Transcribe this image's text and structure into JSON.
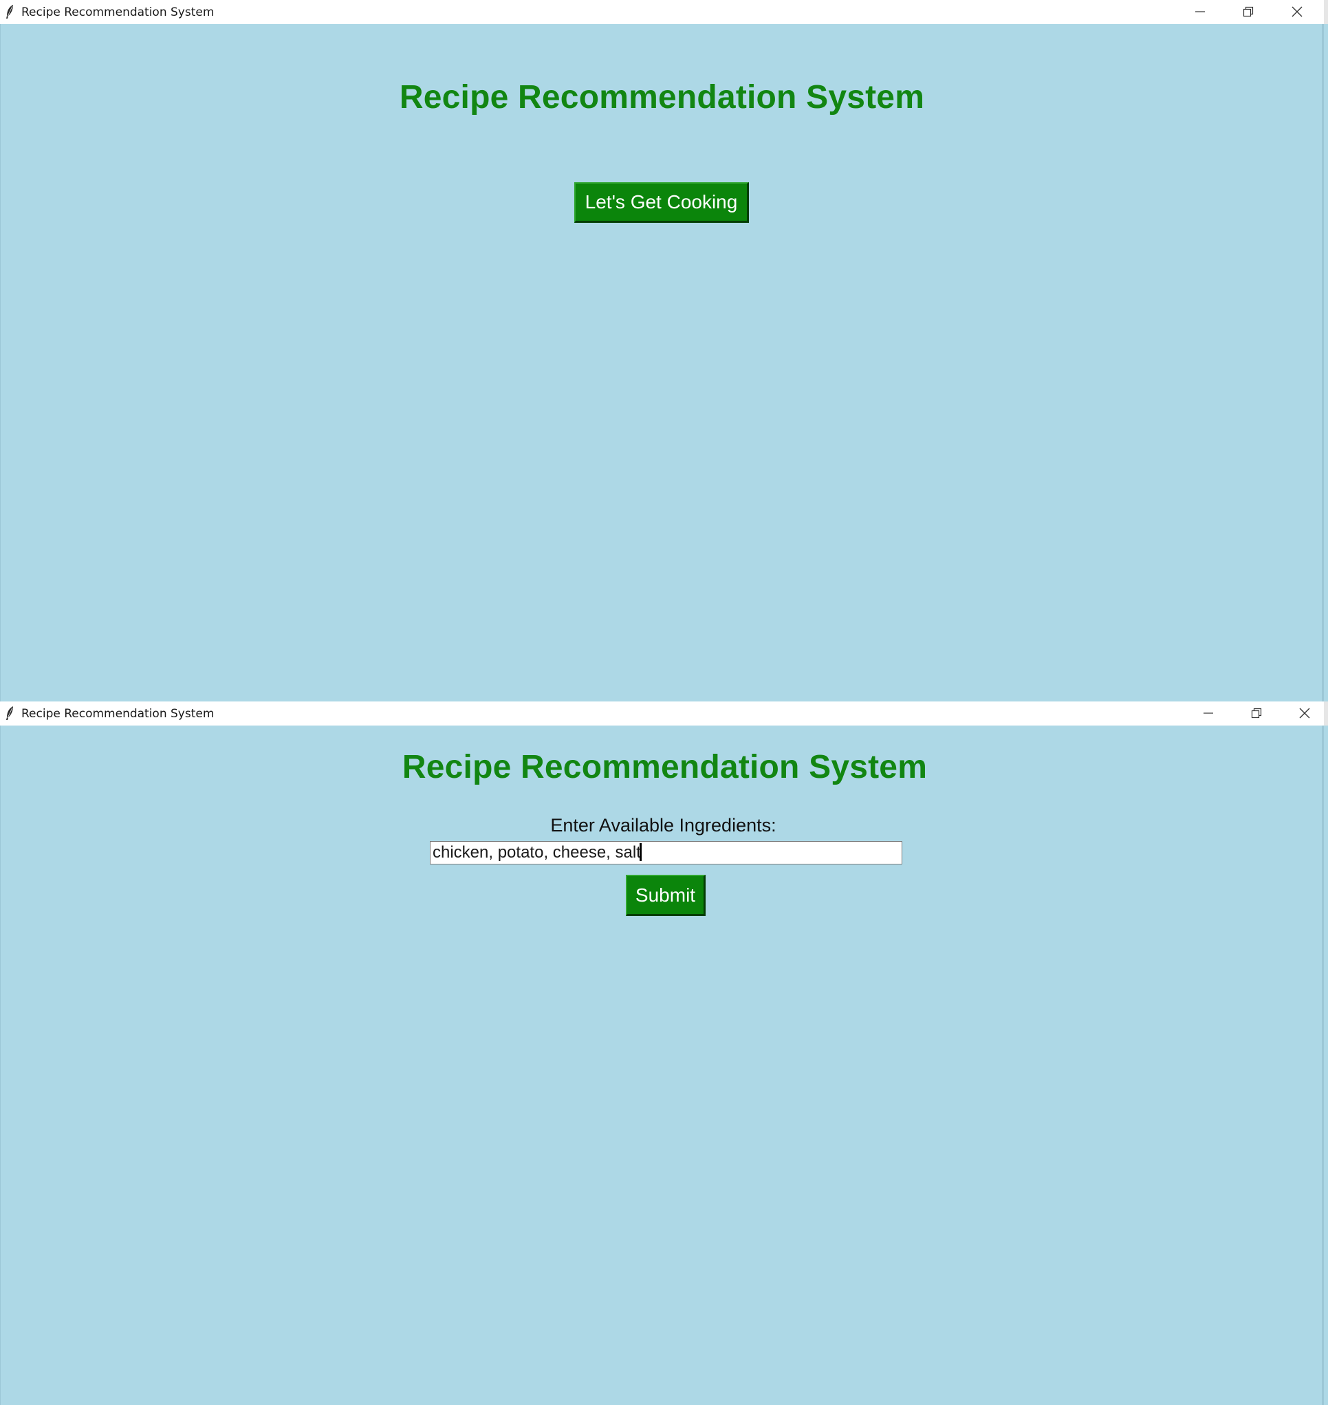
{
  "windows": [
    {
      "title": "Recipe Recommendation System",
      "heading": "Recipe Recommendation System",
      "start_button_label": "Let's Get Cooking"
    },
    {
      "title": "Recipe Recommendation System",
      "heading": "Recipe Recommendation System",
      "ingredients_label": "Enter Available Ingredients:",
      "ingredients_value": "chicken, potato, cheese, salt",
      "submit_label": "Submit"
    }
  ],
  "icons": {
    "app": "feather-icon",
    "minimize": "minimize-icon",
    "restore": "restore-icon",
    "close": "close-icon"
  },
  "colors": {
    "background": "#add8e6",
    "heading": "#128612",
    "button": "#0b850b",
    "button_text": "#ffffff"
  }
}
